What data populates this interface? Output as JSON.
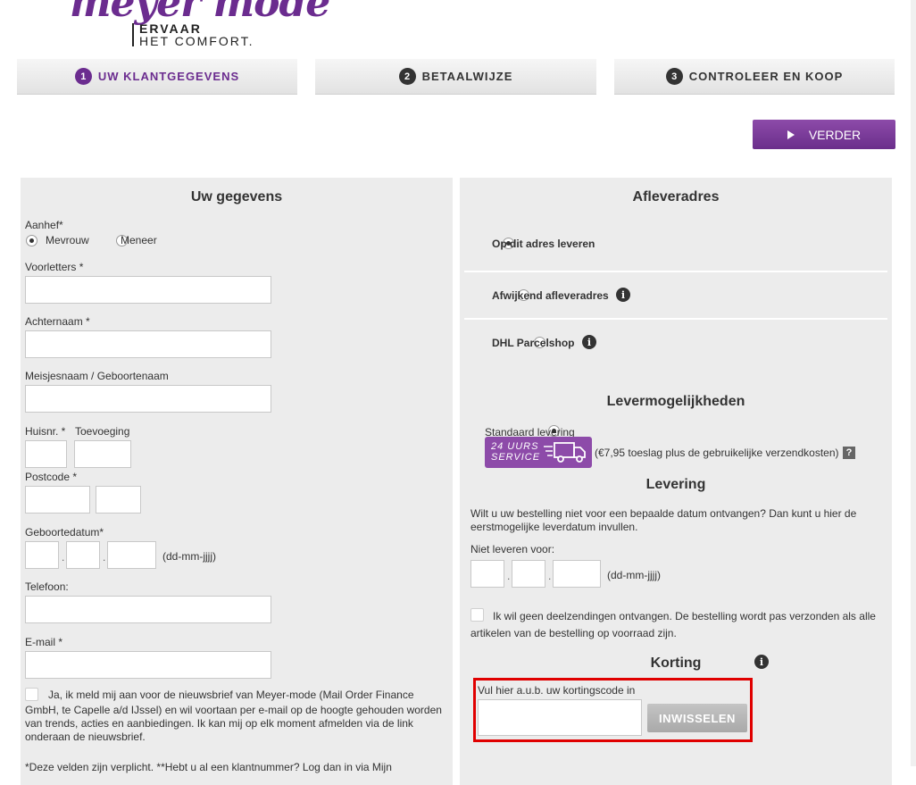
{
  "brand": {
    "script": "meyer mode",
    "line1": "ERVAAR",
    "line2": "HET COMFORT."
  },
  "steps": [
    {
      "num": "1",
      "label": "UW KLANTGEGEVENS"
    },
    {
      "num": "2",
      "label": "BETAALWIJZE"
    },
    {
      "num": "3",
      "label": "CONTROLEER EN KOOP"
    }
  ],
  "verder_label": "VERDER",
  "left": {
    "title": "Uw gegevens",
    "aanhef_label": "Aanhef*",
    "aanhef_options": [
      "Mevrouw",
      "Meneer"
    ],
    "voorletters_label": "Voorletters *",
    "achternaam_label": "Achternaam *",
    "meisjesnaam_label": "Meisjesnaam / Geboortenaam",
    "huisnr_label": "Huisnr. *",
    "toevoeging_label": "Toevoeging",
    "postcode_label": "Postcode *",
    "geboortedatum_label": "Geboortedatum*",
    "date_sep": ".",
    "date_format": "(dd-mm-jjjj)",
    "telefoon_label": "Telefoon:",
    "email_label": "E-mail *",
    "newsletter_line1": "Ja, ik meld mij aan voor de nieuwsbrief van Meyer-mode (Mail Order Finance",
    "newsletter_rest": "GmbH, te Capelle a/d IJssel) en wil voortaan per e-mail op de hoogte gehouden worden van trends, acties en aanbiedingen. Ik kan mij op elk moment afmelden via de link onderaan de nieuwsbrief.",
    "footnote": "*Deze velden zijn verplicht. **Hebt u al een klantnummer? Log dan in via Mijn"
  },
  "right": {
    "title": "Afleveradres",
    "option1": "Op dit adres leveren",
    "option2": "Afwijkend afleveradres",
    "option3": "DHL Parcelshop",
    "info_glyph": "i",
    "lever_title": "Levermogelijkheden",
    "standaard": "Standaard levering",
    "badge_line1": "24 UURS",
    "badge_line2": "SERVICE",
    "toeslag": "(€7,95 toeslag plus de gebruikelijke verzendkosten)",
    "qmark": "?",
    "levering_title": "Levering",
    "levering_text": "Wilt u uw bestelling niet voor een bepaalde datum ontvangen? Dan kunt u hier de eerstmogelijke leverdatum invullen.",
    "niet_leveren": "Niet leveren voor:",
    "date_format": "(dd-mm-jjjj)",
    "date_sep": ".",
    "deel_line1": "Ik wil geen deelzendingen ontvangen. De bestelling wordt pas verzonden als alle",
    "deel_line2": "artikelen van de bestelling op voorraad zijn.",
    "korting_title": "Korting",
    "korting_label": "Vul hier a.u.b. uw kortingscode in",
    "inwisselen": "INWISSELEN"
  },
  "colors": {
    "brand_purple": "#6b2c8f",
    "highlight_red": "#e00000"
  }
}
